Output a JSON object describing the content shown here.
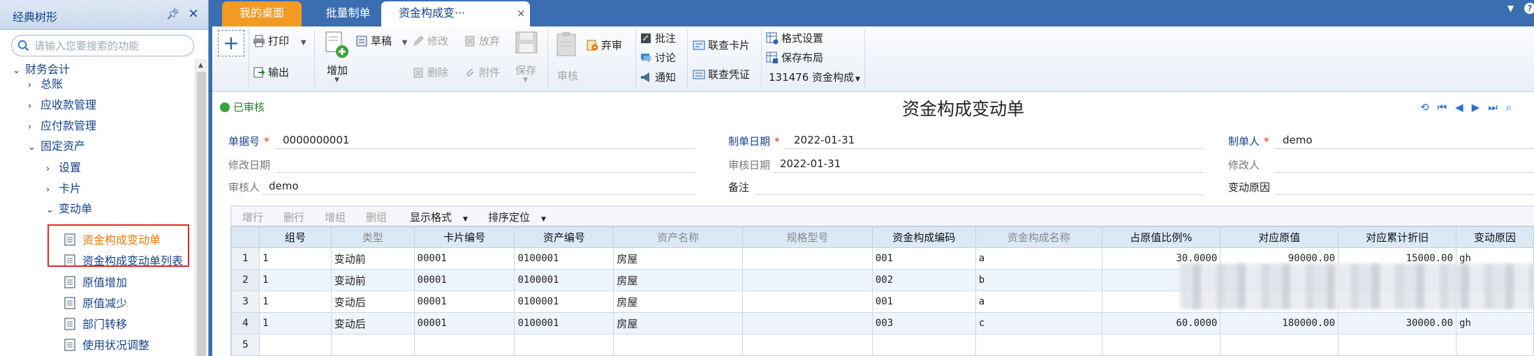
{
  "sidebar": {
    "title": "经典树形",
    "search_placeholder": "请输入您要搜索的功能",
    "tree": [
      {
        "label": "财务会计",
        "arrow": "⌄",
        "active": false
      },
      {
        "label": "总账",
        "arrow": "›",
        "active": false
      },
      {
        "label": "应收款管理",
        "arrow": "›",
        "active": false
      },
      {
        "label": "应付款管理",
        "arrow": "›",
        "active": false
      },
      {
        "label": "固定资产",
        "arrow": "⌄",
        "active": false
      },
      {
        "label": "设置",
        "arrow": "›",
        "active": false
      },
      {
        "label": "卡片",
        "arrow": "›",
        "active": false
      },
      {
        "label": "变动单",
        "arrow": "⌄",
        "active": false
      },
      {
        "label": "资金构成变动单",
        "arrow": "",
        "active": true
      },
      {
        "label": "资金构成变动单列表",
        "arrow": "",
        "active": false
      },
      {
        "label": "原值增加",
        "arrow": "",
        "active": false
      },
      {
        "label": "原值减少",
        "arrow": "",
        "active": false
      },
      {
        "label": "部门转移",
        "arrow": "",
        "active": false
      },
      {
        "label": "使用状况调整",
        "arrow": "",
        "active": false
      }
    ]
  },
  "tabs": {
    "desktop": "我的桌面",
    "batch": "批量制单",
    "current": "资金构成变···",
    "close": "×"
  },
  "toolbar": {
    "print": "打印",
    "export": "输出",
    "add": "增加",
    "draft": "草稿",
    "modify": "修改",
    "abandon": "放弃",
    "delete": "删除",
    "attach": "附件",
    "save": "保存",
    "audit": "审核",
    "unaudit": "弃审",
    "annotate": "批注",
    "discuss": "讨论",
    "notify": "通知",
    "linked_card": "联查卡片",
    "linked_voucher": "联查凭证",
    "format_settings": "格式设置",
    "save_layout": "保存布局",
    "template": "131476 资金构成"
  },
  "doc": {
    "status": "已审核",
    "title": "资金构成变动单"
  },
  "form": {
    "doc_no_label": "单据号",
    "doc_no": "0000000001",
    "make_date_label": "制单日期",
    "make_date": "2022-01-31",
    "maker_label": "制单人",
    "maker": "demo",
    "modify_date_label": "修改日期",
    "audit_date_label": "审核日期",
    "audit_date": "2022-01-31",
    "modifier_label": "修改人",
    "auditor_label": "审核人",
    "auditor": "demo",
    "remark_label": "备注",
    "change_reason_label": "变动原因"
  },
  "grid": {
    "tools": {
      "add_row": "增行",
      "del_row": "删行",
      "add_group": "增组",
      "del_group": "删组",
      "display_format": "显示格式",
      "sort_position": "排序定位"
    },
    "columns": [
      "组号",
      "类型",
      "卡片编号",
      "资产编号",
      "资产名称",
      "规格型号",
      "资金构成编码",
      "资金构成名称",
      "占原值比例%",
      "对应原值",
      "对应累计折旧",
      "变动原因"
    ],
    "rows": [
      {
        "n": "1",
        "cells": [
          "1",
          "变动前",
          "00001",
          "0100001",
          "房屋",
          "",
          "001",
          "a",
          "30.0000",
          "90000.00",
          "15000.00",
          "gh"
        ]
      },
      {
        "n": "2",
        "cells": [
          "1",
          "变动前",
          "00001",
          "0100001",
          "房屋",
          "",
          "002",
          "b",
          "",
          "",
          "",
          ""
        ]
      },
      {
        "n": "3",
        "cells": [
          "1",
          "变动后",
          "00001",
          "0100001",
          "房屋",
          "",
          "001",
          "a",
          "",
          "",
          "",
          ""
        ]
      },
      {
        "n": "4",
        "cells": [
          "1",
          "变动后",
          "00001",
          "0100001",
          "房屋",
          "",
          "003",
          "c",
          "60.0000",
          "180000.00",
          "30000.00",
          "gh"
        ]
      },
      {
        "n": "5",
        "cells": [
          "",
          "",
          "",
          "",
          "",
          "",
          "",
          "",
          "",
          "",
          "",
          ""
        ]
      }
    ]
  }
}
